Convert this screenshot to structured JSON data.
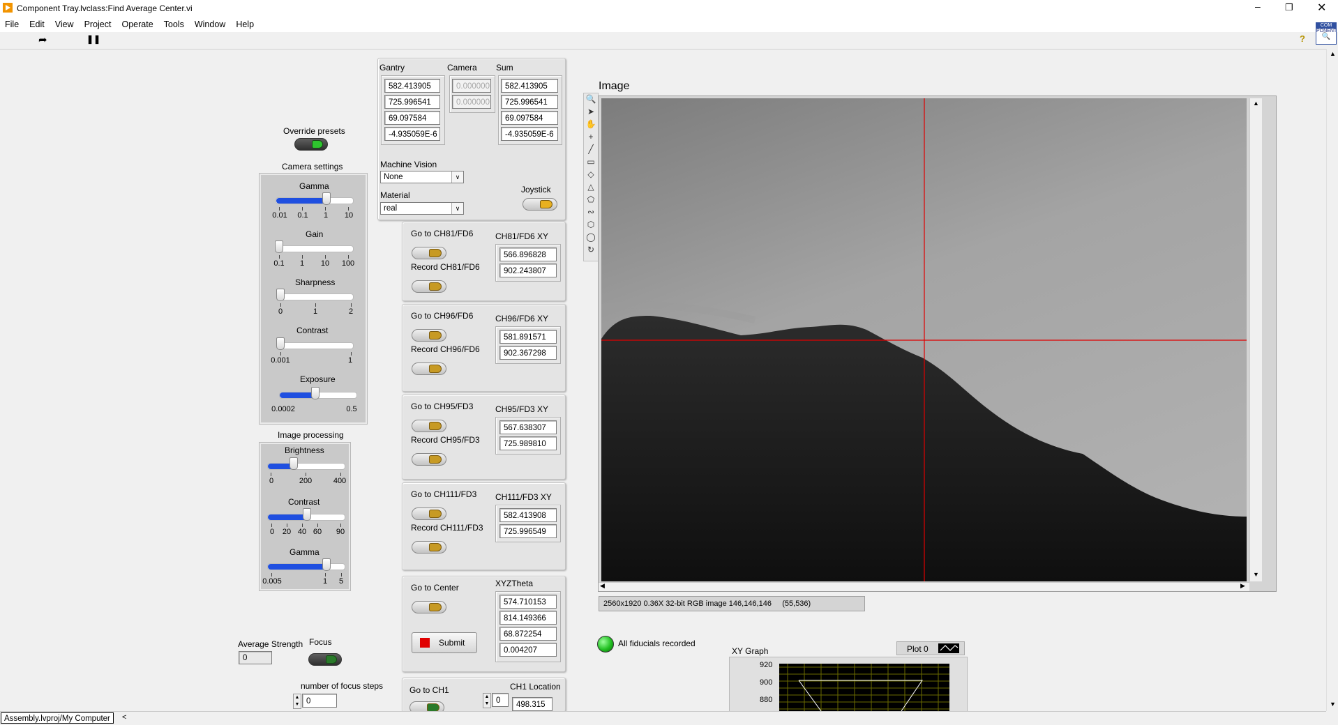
{
  "window": {
    "title": "Component Tray.lvclass:Find Average Center.vi",
    "min_icon": "minimize-icon",
    "max_icon": "maximize-icon",
    "close_icon": "close-icon"
  },
  "menu": [
    "File",
    "Edit",
    "View",
    "Project",
    "Operate",
    "Tools",
    "Window",
    "Help"
  ],
  "camera_settings": {
    "override_label": "Override presets",
    "title": "Camera settings",
    "gamma": {
      "label": "Gamma",
      "ticks": [
        "0.01",
        "0.1",
        "1",
        "10"
      ],
      "value": 1.2
    },
    "gain": {
      "label": "Gain",
      "ticks": [
        "0.1",
        "1",
        "10",
        "100"
      ],
      "value": 0.1
    },
    "sharpness": {
      "label": "Sharpness",
      "ticks": [
        "0",
        "1",
        "2"
      ],
      "value": 0
    },
    "contrast": {
      "label": "Contrast",
      "ticks": [
        "0.001",
        "1"
      ],
      "value": 0.001
    },
    "exposure": {
      "label": "Exposure",
      "ticks": [
        "0.0002",
        "0.5"
      ],
      "value": 0.05
    }
  },
  "image_processing": {
    "title": "Image processing",
    "brightness": {
      "label": "Brightness",
      "ticks": [
        "0",
        "200",
        "400"
      ],
      "value": 120
    },
    "contrast": {
      "label": "Contrast",
      "ticks": [
        "0",
        "20",
        "40",
        "60",
        "90"
      ],
      "value": 45
    },
    "gamma": {
      "label": "Gamma",
      "ticks": [
        "0.005",
        "1",
        "5"
      ],
      "value": 1
    }
  },
  "average_strength": {
    "label": "Average Strength",
    "value": "0"
  },
  "focus": {
    "label": "Focus"
  },
  "focus_steps": {
    "label": "number of focus steps",
    "value": "0"
  },
  "coords": {
    "gantry_label": "Gantry",
    "camera_label": "Camera",
    "sum_label": "Sum",
    "gantry": [
      "582.413905",
      "725.996541",
      "69.097584",
      "-4.935059E-6"
    ],
    "camera": [
      "0.000000",
      "0.000000"
    ],
    "sum": [
      "582.413905",
      "725.996541",
      "69.097584",
      "-4.935059E-6"
    ],
    "machine_vision_label": "Machine Vision",
    "machine_vision_value": "None",
    "material_label": "Material",
    "material_value": "real",
    "joystick_label": "Joystick"
  },
  "fiducials": [
    {
      "goto": "Go to CH81/FD6",
      "record": "Record CH81/FD6",
      "xy_label": "CH81/FD6 XY",
      "xy": [
        "566.896828",
        "902.243807"
      ]
    },
    {
      "goto": "Go to CH96/FD6",
      "record": "Record CH96/FD6",
      "xy_label": "CH96/FD6 XY",
      "xy": [
        "581.891571",
        "902.367298"
      ]
    },
    {
      "goto": "Go to CH95/FD3",
      "record": "Record CH95/FD3",
      "xy_label": "CH95/FD3 XY",
      "xy": [
        "567.638307",
        "725.989810"
      ]
    },
    {
      "goto": "Go to CH111/FD3",
      "record": "Record CH111/FD3",
      "xy_label": "CH111/FD3 XY",
      "xy": [
        "582.413908",
        "725.996549"
      ]
    }
  ],
  "center": {
    "goto": "Go to Center",
    "xyz_label": "XYZTheta",
    "xyz": [
      "574.710153",
      "814.149366",
      "68.872254",
      "0.004207"
    ],
    "submit": "Submit"
  },
  "ch1": {
    "goto": "Go to CH1",
    "loc_label": "CH1 Location",
    "stepper_value": "0",
    "location": "498.315"
  },
  "image": {
    "label": "Image",
    "status": "2560x1920 0.36X 32-bit RGB image 146,146,146     (55,536)"
  },
  "fiducials_indicator": {
    "label": "All fiducials recorded"
  },
  "xy_graph": {
    "label": "XY Graph",
    "plot_label": "Plot 0",
    "y_ticks": [
      "920",
      "900",
      "880"
    ]
  },
  "status_bar": {
    "path": "Assembly.lvproj/My Computer"
  },
  "colors": {
    "accent_blue": "#1f4fe0",
    "led_green": "#22c022",
    "crosshair": "#e00000",
    "submit_red": "#e00000"
  }
}
